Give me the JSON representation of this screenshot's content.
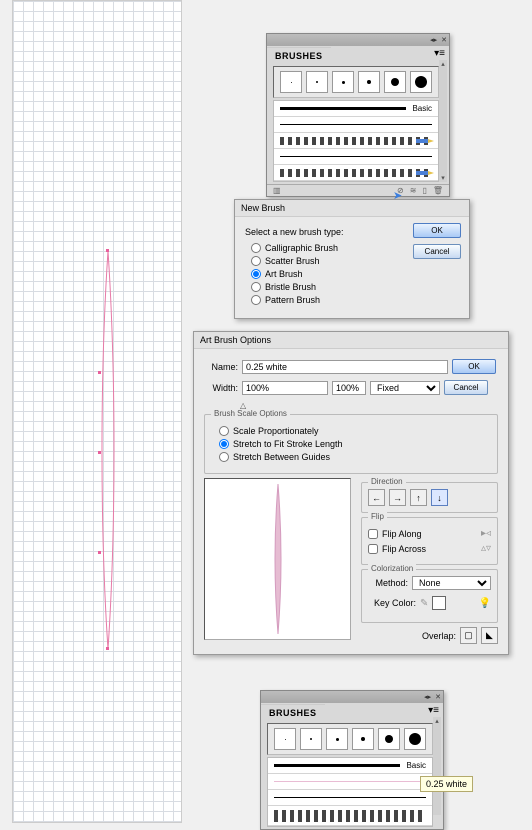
{
  "brushes_panel": {
    "title": "BRUSHES",
    "basic_label": "Basic",
    "thumb_sizes": [
      1,
      2,
      3,
      4,
      8,
      12
    ]
  },
  "new_brush_dialog": {
    "title": "New Brush",
    "prompt": "Select a new brush type:",
    "options": {
      "calligraphic": "Calligraphic Brush",
      "scatter": "Scatter Brush",
      "art": "Art Brush",
      "bristle": "Bristle Brush",
      "pattern": "Pattern Brush"
    },
    "ok": "OK",
    "cancel": "Cancel"
  },
  "art_brush_options": {
    "title": "Art Brush Options",
    "name_label": "Name:",
    "name_value": "0.25 white",
    "width_label": "Width:",
    "width_left": "100%",
    "width_right": "100%",
    "width_mode": "Fixed",
    "ok": "OK",
    "cancel": "Cancel",
    "scale": {
      "title": "Brush Scale Options",
      "prop": "Scale Proportionately",
      "stretch": "Stretch to Fit Stroke Length",
      "guides": "Stretch Between Guides"
    },
    "direction_title": "Direction",
    "flip": {
      "title": "Flip",
      "along": "Flip Along",
      "across": "Flip Across"
    },
    "colorization": {
      "title": "Colorization",
      "method_label": "Method:",
      "method_value": "None",
      "keycolor_label": "Key Color:"
    },
    "overlap_label": "Overlap:"
  },
  "tooltip_text": "0.25 white"
}
